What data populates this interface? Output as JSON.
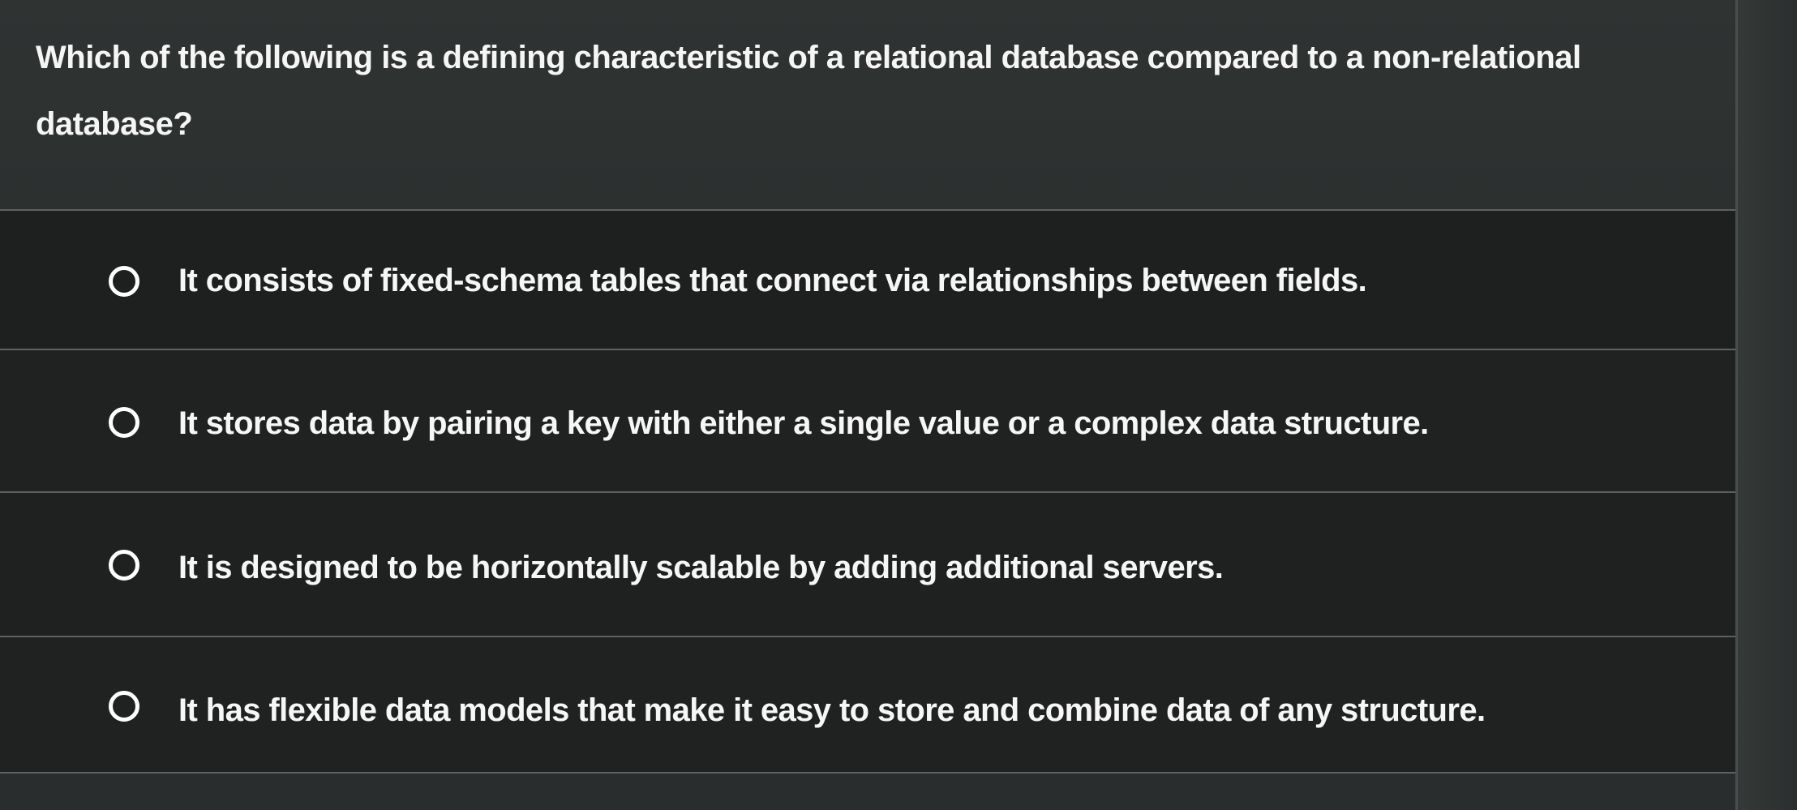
{
  "question": {
    "text": "Which of the following is a defining characteristic of a relational database compared to a non-relational database?"
  },
  "options": [
    {
      "label": "It consists of fixed-schema tables that connect via relationships between fields.",
      "selected": false
    },
    {
      "label": "It stores data by pairing a key with either a single value or a complex data structure.",
      "selected": false
    },
    {
      "label": "It is designed to be horizontally scalable by adding additional servers.",
      "selected": false
    },
    {
      "label": "It has flexible data models that make it easy to store and combine data of any structure.",
      "selected": false
    }
  ],
  "colors": {
    "background": "#26292a",
    "text": "#f4f5f4",
    "divider": "#5d6261",
    "radio": "#ffffff"
  }
}
